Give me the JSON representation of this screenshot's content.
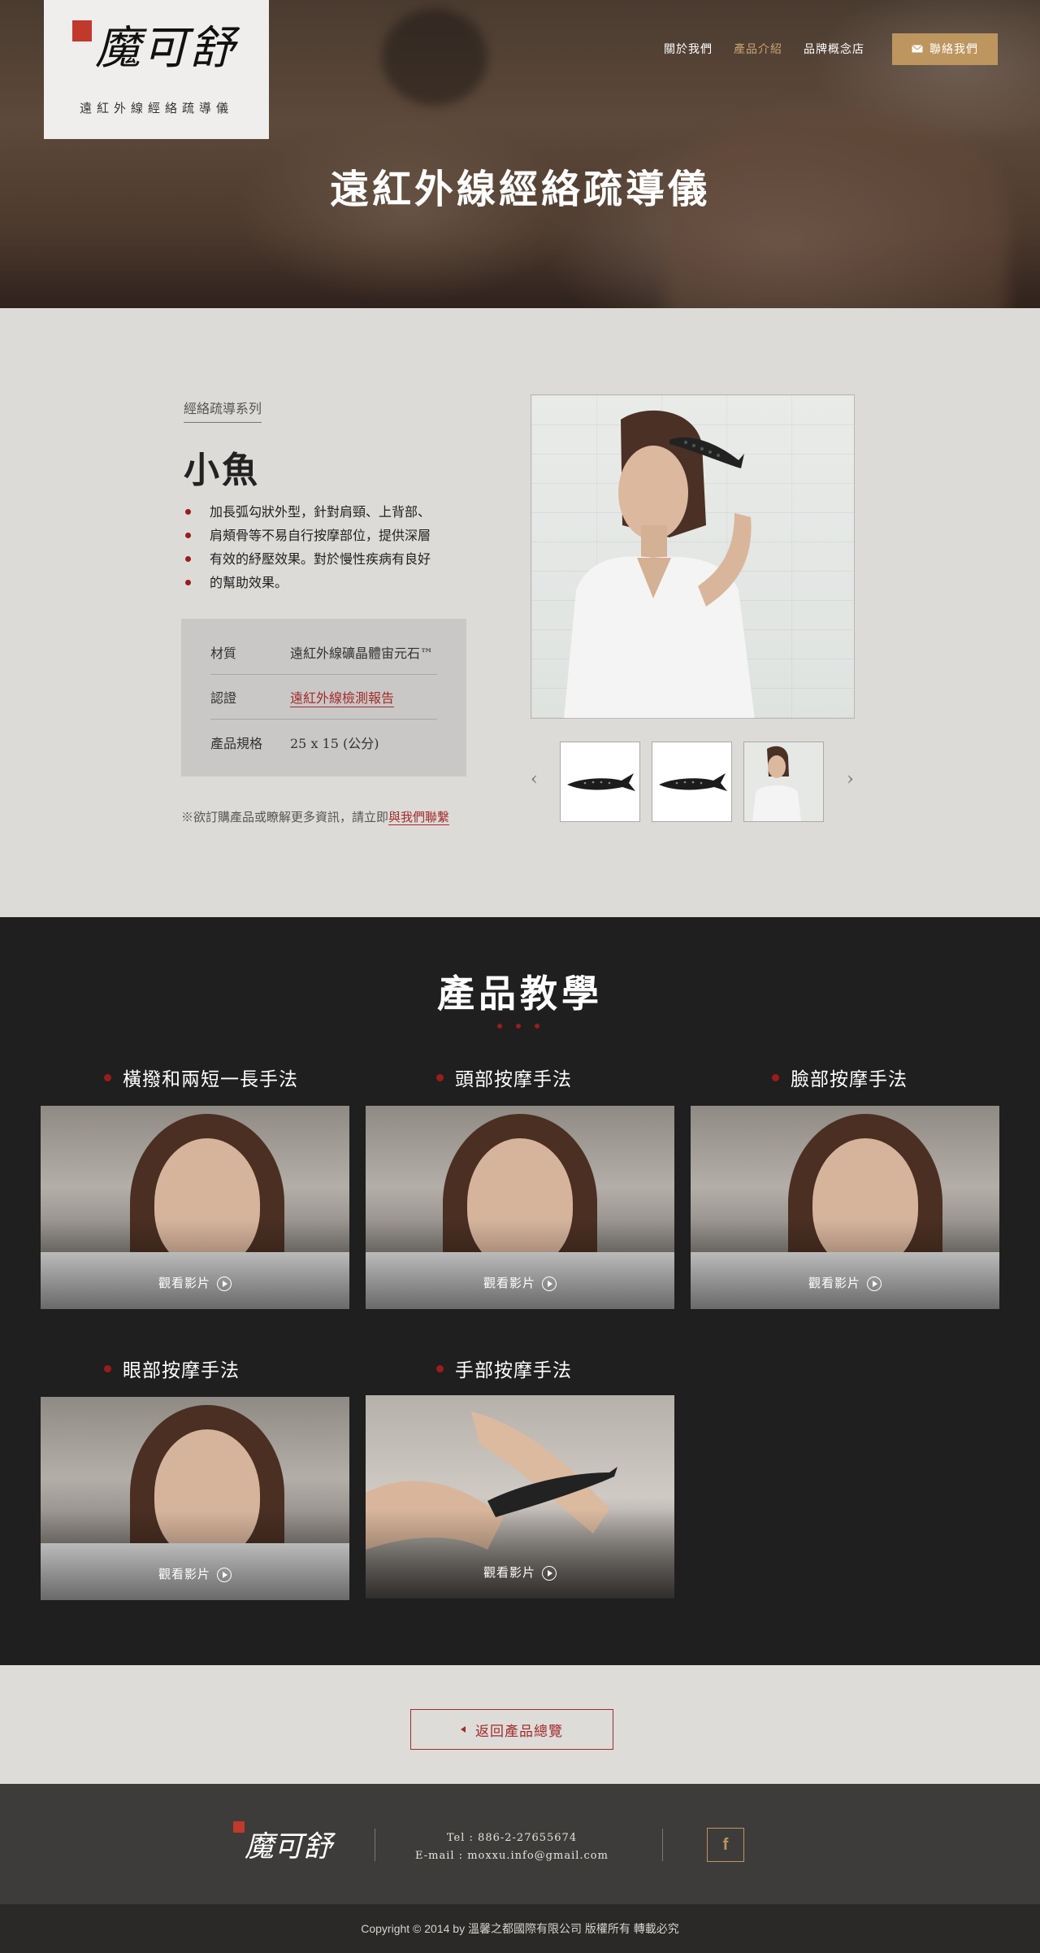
{
  "brand": {
    "logo_text": "魔可舒",
    "subtitle": "遠紅外線經絡疏導儀"
  },
  "nav": {
    "items": [
      {
        "label": "關於我們",
        "active": false
      },
      {
        "label": "產品介紹",
        "active": true
      },
      {
        "label": "品牌概念店",
        "active": false
      }
    ],
    "contact_label": "聯絡我們",
    "contact_icon": "envelope-icon"
  },
  "hero": {
    "title": "遠紅外線經絡疏導儀"
  },
  "product": {
    "series": "經絡疏導系列",
    "name": "小魚",
    "description": [
      "加長弧勾狀外型，針對肩頸、上背部、",
      "肩頰骨等不易自行按摩部位，提供深層",
      "有效的紓壓效果。對於慢性疾病有良好",
      "的幫助效果。"
    ],
    "specs": [
      {
        "key": "材質",
        "value": "遠紅外線礦晶體宙元石™"
      },
      {
        "key": "認證",
        "value": "遠紅外線檢測報告"
      },
      {
        "key": "產品規格",
        "value": "25 x 15 (公分)"
      }
    ],
    "order_note": "※欲訂購產品或瞭解更多資訊，請立即",
    "order_link": "與我們聯繫",
    "prev_arrow": "‹",
    "next_arrow": "›"
  },
  "tutorial": {
    "title": "產品教學",
    "watch_label": "觀看影片",
    "cards": [
      {
        "title": "橫撥和兩短一長手法"
      },
      {
        "title": "頭部按摩手法"
      },
      {
        "title": "臉部按摩手法"
      },
      {
        "title": "眼部按摩手法"
      },
      {
        "title": "手部按摩手法"
      }
    ]
  },
  "back": {
    "label": "返回產品總覽"
  },
  "footer": {
    "logo_text": "魔可舒",
    "tel": "Tel : 886-2-27655674",
    "email": "E-mail :  moxxu.info@gmail.com",
    "facebook_icon": "facebook-icon",
    "facebook_glyph": "f",
    "copyright": "Copyright © 2014 by 溫馨之都國際有限公司 版權所有 轉載必究"
  },
  "colors": {
    "accent_gold": "#bd955f",
    "accent_red": "#a32b2b",
    "dark": "#1f1f20"
  }
}
